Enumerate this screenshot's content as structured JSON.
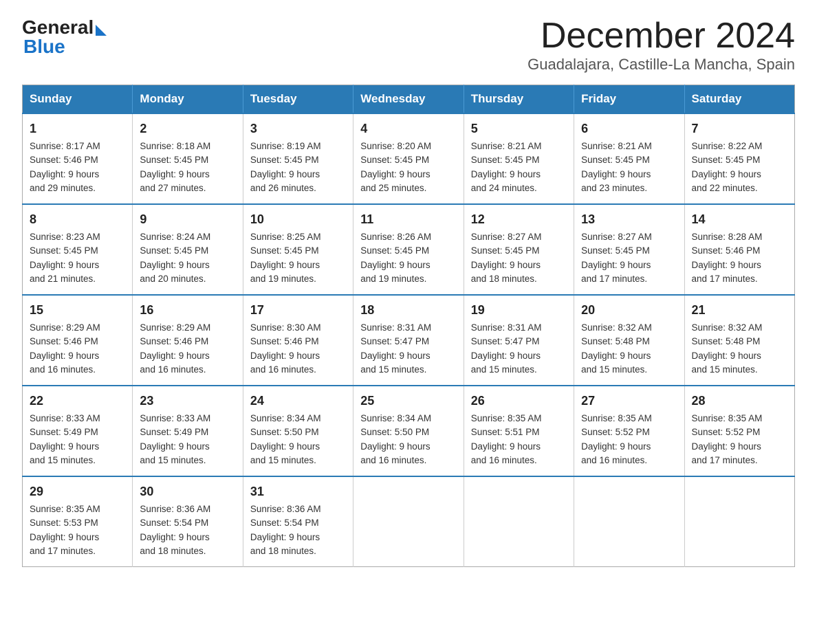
{
  "header": {
    "logo_general": "General",
    "logo_blue": "Blue",
    "month_title": "December 2024",
    "location": "Guadalajara, Castille-La Mancha, Spain"
  },
  "weekdays": [
    "Sunday",
    "Monday",
    "Tuesday",
    "Wednesday",
    "Thursday",
    "Friday",
    "Saturday"
  ],
  "weeks": [
    [
      {
        "day": "1",
        "sunrise": "8:17 AM",
        "sunset": "5:46 PM",
        "daylight": "9 hours and 29 minutes."
      },
      {
        "day": "2",
        "sunrise": "8:18 AM",
        "sunset": "5:45 PM",
        "daylight": "9 hours and 27 minutes."
      },
      {
        "day": "3",
        "sunrise": "8:19 AM",
        "sunset": "5:45 PM",
        "daylight": "9 hours and 26 minutes."
      },
      {
        "day": "4",
        "sunrise": "8:20 AM",
        "sunset": "5:45 PM",
        "daylight": "9 hours and 25 minutes."
      },
      {
        "day": "5",
        "sunrise": "8:21 AM",
        "sunset": "5:45 PM",
        "daylight": "9 hours and 24 minutes."
      },
      {
        "day": "6",
        "sunrise": "8:21 AM",
        "sunset": "5:45 PM",
        "daylight": "9 hours and 23 minutes."
      },
      {
        "day": "7",
        "sunrise": "8:22 AM",
        "sunset": "5:45 PM",
        "daylight": "9 hours and 22 minutes."
      }
    ],
    [
      {
        "day": "8",
        "sunrise": "8:23 AM",
        "sunset": "5:45 PM",
        "daylight": "9 hours and 21 minutes."
      },
      {
        "day": "9",
        "sunrise": "8:24 AM",
        "sunset": "5:45 PM",
        "daylight": "9 hours and 20 minutes."
      },
      {
        "day": "10",
        "sunrise": "8:25 AM",
        "sunset": "5:45 PM",
        "daylight": "9 hours and 19 minutes."
      },
      {
        "day": "11",
        "sunrise": "8:26 AM",
        "sunset": "5:45 PM",
        "daylight": "9 hours and 19 minutes."
      },
      {
        "day": "12",
        "sunrise": "8:27 AM",
        "sunset": "5:45 PM",
        "daylight": "9 hours and 18 minutes."
      },
      {
        "day": "13",
        "sunrise": "8:27 AM",
        "sunset": "5:45 PM",
        "daylight": "9 hours and 17 minutes."
      },
      {
        "day": "14",
        "sunrise": "8:28 AM",
        "sunset": "5:46 PM",
        "daylight": "9 hours and 17 minutes."
      }
    ],
    [
      {
        "day": "15",
        "sunrise": "8:29 AM",
        "sunset": "5:46 PM",
        "daylight": "9 hours and 16 minutes."
      },
      {
        "day": "16",
        "sunrise": "8:29 AM",
        "sunset": "5:46 PM",
        "daylight": "9 hours and 16 minutes."
      },
      {
        "day": "17",
        "sunrise": "8:30 AM",
        "sunset": "5:46 PM",
        "daylight": "9 hours and 16 minutes."
      },
      {
        "day": "18",
        "sunrise": "8:31 AM",
        "sunset": "5:47 PM",
        "daylight": "9 hours and 15 minutes."
      },
      {
        "day": "19",
        "sunrise": "8:31 AM",
        "sunset": "5:47 PM",
        "daylight": "9 hours and 15 minutes."
      },
      {
        "day": "20",
        "sunrise": "8:32 AM",
        "sunset": "5:48 PM",
        "daylight": "9 hours and 15 minutes."
      },
      {
        "day": "21",
        "sunrise": "8:32 AM",
        "sunset": "5:48 PM",
        "daylight": "9 hours and 15 minutes."
      }
    ],
    [
      {
        "day": "22",
        "sunrise": "8:33 AM",
        "sunset": "5:49 PM",
        "daylight": "9 hours and 15 minutes."
      },
      {
        "day": "23",
        "sunrise": "8:33 AM",
        "sunset": "5:49 PM",
        "daylight": "9 hours and 15 minutes."
      },
      {
        "day": "24",
        "sunrise": "8:34 AM",
        "sunset": "5:50 PM",
        "daylight": "9 hours and 15 minutes."
      },
      {
        "day": "25",
        "sunrise": "8:34 AM",
        "sunset": "5:50 PM",
        "daylight": "9 hours and 16 minutes."
      },
      {
        "day": "26",
        "sunrise": "8:35 AM",
        "sunset": "5:51 PM",
        "daylight": "9 hours and 16 minutes."
      },
      {
        "day": "27",
        "sunrise": "8:35 AM",
        "sunset": "5:52 PM",
        "daylight": "9 hours and 16 minutes."
      },
      {
        "day": "28",
        "sunrise": "8:35 AM",
        "sunset": "5:52 PM",
        "daylight": "9 hours and 17 minutes."
      }
    ],
    [
      {
        "day": "29",
        "sunrise": "8:35 AM",
        "sunset": "5:53 PM",
        "daylight": "9 hours and 17 minutes."
      },
      {
        "day": "30",
        "sunrise": "8:36 AM",
        "sunset": "5:54 PM",
        "daylight": "9 hours and 18 minutes."
      },
      {
        "day": "31",
        "sunrise": "8:36 AM",
        "sunset": "5:54 PM",
        "daylight": "9 hours and 18 minutes."
      },
      null,
      null,
      null,
      null
    ]
  ]
}
